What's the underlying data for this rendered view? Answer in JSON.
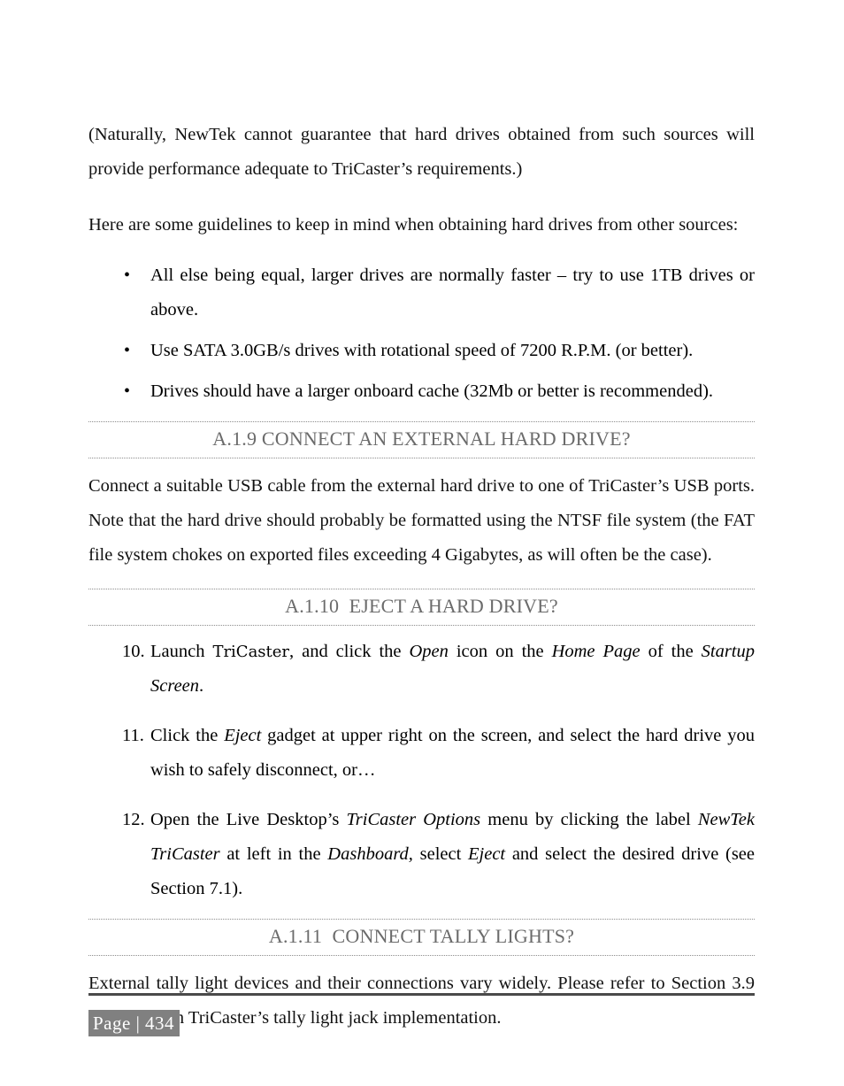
{
  "document": {
    "page_background": "#ffffff",
    "text_color": "#111111",
    "heading_color": "#6b6b6b",
    "rule_color": "#4a4a4a",
    "badge_background": "#808080",
    "badge_text_color": "#ffffff"
  },
  "body": {
    "para_1": "(Naturally, NewTek cannot guarantee that hard drives obtained from such sources will provide performance adequate to TriCaster’s requirements.)",
    "para_2": "Here are some guidelines to keep in mind when obtaining hard drives from other sources:",
    "bullets": [
      {
        "marker": "•",
        "text": "All else being equal, larger drives are normally faster – try to use 1TB drives or above."
      },
      {
        "marker": "•",
        "text": "Use SATA 3.0GB/s drives with rotational speed of 7200 R.P.M. (or better)."
      },
      {
        "marker": "•",
        "text": "Drives should have a larger onboard cache (32Mb or better is recommended)."
      }
    ]
  },
  "sections": {
    "a19": {
      "number": "A.1.9",
      "title": "CONNECT AN EXTERNAL HARD DRIVE?",
      "body": "Connect a suitable USB cable from the external hard drive to one of TriCaster’s USB ports.  Note that the hard drive should probably be formatted using the NTSF file system (the FAT file system chokes on exported files exceeding 4 Gigabytes, as will often be the case)."
    },
    "a110": {
      "number": "A.1.10",
      "title": "EJECT A HARD DRIVE?",
      "items": [
        {
          "marker": "10.",
          "run_1": "Launch ",
          "run_tricaster": "TriCaster",
          "run_2": ", and click the ",
          "run_open": "Open",
          "run_3": " icon on the ",
          "run_home_page": "Home Page",
          "run_4": " of the ",
          "run_startup_screen": "Startup Screen",
          "run_5": "."
        },
        {
          "marker": "11.",
          "run_1": "Click the ",
          "run_eject": "Eject",
          "run_2": " gadget at upper right on the screen, and select the hard drive you wish to safely disconnect, or…"
        },
        {
          "marker": "12.",
          "run_1": "Open the Live Desktop’s ",
          "run_tricaster_options": "TriCaster Options",
          "run_2": " menu by clicking the label ",
          "run_newtek_tricaster": "NewTek TriCaster",
          "run_3": " at left in the ",
          "run_dashboard": "Dashboard,",
          "run_4": " select ",
          "run_eject": "Eject",
          "run_5": " and select the desired drive (see Section 7.1)."
        }
      ]
    },
    "a111": {
      "number": "A.1.11",
      "title": "CONNECT TALLY LIGHTS?",
      "body": "External tally light devices and their connections vary widely.  Please refer to Section 3.9 for details on TriCaster’s tally light jack implementation."
    }
  },
  "footer": {
    "page_label": "Page | 434"
  }
}
